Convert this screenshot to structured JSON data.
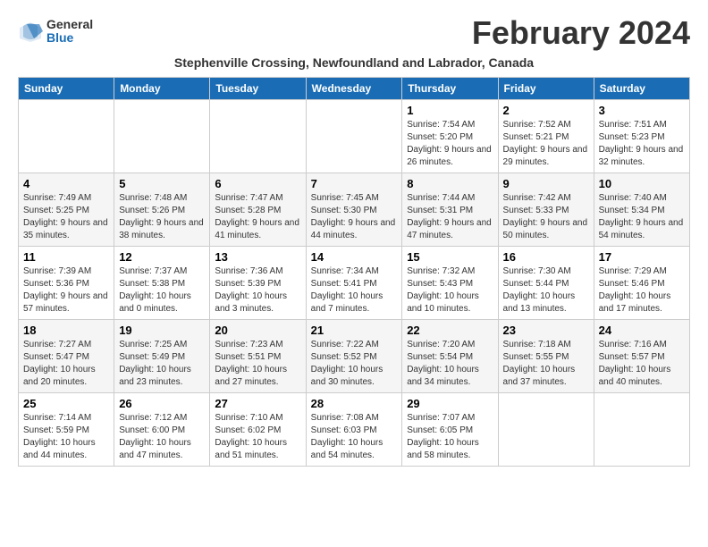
{
  "header": {
    "logo_general": "General",
    "logo_blue": "Blue",
    "month_title": "February 2024",
    "subtitle": "Stephenville Crossing, Newfoundland and Labrador, Canada"
  },
  "weekdays": [
    "Sunday",
    "Monday",
    "Tuesday",
    "Wednesday",
    "Thursday",
    "Friday",
    "Saturday"
  ],
  "weeks": [
    [
      {
        "day": "",
        "info": ""
      },
      {
        "day": "",
        "info": ""
      },
      {
        "day": "",
        "info": ""
      },
      {
        "day": "",
        "info": ""
      },
      {
        "day": "1",
        "info": "Sunrise: 7:54 AM\nSunset: 5:20 PM\nDaylight: 9 hours and 26 minutes."
      },
      {
        "day": "2",
        "info": "Sunrise: 7:52 AM\nSunset: 5:21 PM\nDaylight: 9 hours and 29 minutes."
      },
      {
        "day": "3",
        "info": "Sunrise: 7:51 AM\nSunset: 5:23 PM\nDaylight: 9 hours and 32 minutes."
      }
    ],
    [
      {
        "day": "4",
        "info": "Sunrise: 7:49 AM\nSunset: 5:25 PM\nDaylight: 9 hours and 35 minutes."
      },
      {
        "day": "5",
        "info": "Sunrise: 7:48 AM\nSunset: 5:26 PM\nDaylight: 9 hours and 38 minutes."
      },
      {
        "day": "6",
        "info": "Sunrise: 7:47 AM\nSunset: 5:28 PM\nDaylight: 9 hours and 41 minutes."
      },
      {
        "day": "7",
        "info": "Sunrise: 7:45 AM\nSunset: 5:30 PM\nDaylight: 9 hours and 44 minutes."
      },
      {
        "day": "8",
        "info": "Sunrise: 7:44 AM\nSunset: 5:31 PM\nDaylight: 9 hours and 47 minutes."
      },
      {
        "day": "9",
        "info": "Sunrise: 7:42 AM\nSunset: 5:33 PM\nDaylight: 9 hours and 50 minutes."
      },
      {
        "day": "10",
        "info": "Sunrise: 7:40 AM\nSunset: 5:34 PM\nDaylight: 9 hours and 54 minutes."
      }
    ],
    [
      {
        "day": "11",
        "info": "Sunrise: 7:39 AM\nSunset: 5:36 PM\nDaylight: 9 hours and 57 minutes."
      },
      {
        "day": "12",
        "info": "Sunrise: 7:37 AM\nSunset: 5:38 PM\nDaylight: 10 hours and 0 minutes."
      },
      {
        "day": "13",
        "info": "Sunrise: 7:36 AM\nSunset: 5:39 PM\nDaylight: 10 hours and 3 minutes."
      },
      {
        "day": "14",
        "info": "Sunrise: 7:34 AM\nSunset: 5:41 PM\nDaylight: 10 hours and 7 minutes."
      },
      {
        "day": "15",
        "info": "Sunrise: 7:32 AM\nSunset: 5:43 PM\nDaylight: 10 hours and 10 minutes."
      },
      {
        "day": "16",
        "info": "Sunrise: 7:30 AM\nSunset: 5:44 PM\nDaylight: 10 hours and 13 minutes."
      },
      {
        "day": "17",
        "info": "Sunrise: 7:29 AM\nSunset: 5:46 PM\nDaylight: 10 hours and 17 minutes."
      }
    ],
    [
      {
        "day": "18",
        "info": "Sunrise: 7:27 AM\nSunset: 5:47 PM\nDaylight: 10 hours and 20 minutes."
      },
      {
        "day": "19",
        "info": "Sunrise: 7:25 AM\nSunset: 5:49 PM\nDaylight: 10 hours and 23 minutes."
      },
      {
        "day": "20",
        "info": "Sunrise: 7:23 AM\nSunset: 5:51 PM\nDaylight: 10 hours and 27 minutes."
      },
      {
        "day": "21",
        "info": "Sunrise: 7:22 AM\nSunset: 5:52 PM\nDaylight: 10 hours and 30 minutes."
      },
      {
        "day": "22",
        "info": "Sunrise: 7:20 AM\nSunset: 5:54 PM\nDaylight: 10 hours and 34 minutes."
      },
      {
        "day": "23",
        "info": "Sunrise: 7:18 AM\nSunset: 5:55 PM\nDaylight: 10 hours and 37 minutes."
      },
      {
        "day": "24",
        "info": "Sunrise: 7:16 AM\nSunset: 5:57 PM\nDaylight: 10 hours and 40 minutes."
      }
    ],
    [
      {
        "day": "25",
        "info": "Sunrise: 7:14 AM\nSunset: 5:59 PM\nDaylight: 10 hours and 44 minutes."
      },
      {
        "day": "26",
        "info": "Sunrise: 7:12 AM\nSunset: 6:00 PM\nDaylight: 10 hours and 47 minutes."
      },
      {
        "day": "27",
        "info": "Sunrise: 7:10 AM\nSunset: 6:02 PM\nDaylight: 10 hours and 51 minutes."
      },
      {
        "day": "28",
        "info": "Sunrise: 7:08 AM\nSunset: 6:03 PM\nDaylight: 10 hours and 54 minutes."
      },
      {
        "day": "29",
        "info": "Sunrise: 7:07 AM\nSunset: 6:05 PM\nDaylight: 10 hours and 58 minutes."
      },
      {
        "day": "",
        "info": ""
      },
      {
        "day": "",
        "info": ""
      }
    ]
  ]
}
